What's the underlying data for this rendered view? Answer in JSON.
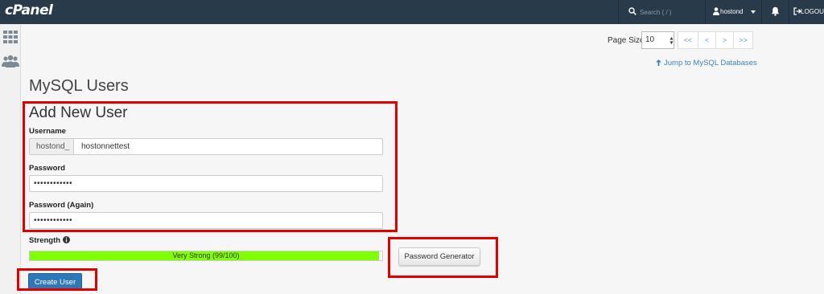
{
  "topbar": {
    "logo": "cPanel",
    "search_placeholder": "Search ( / )",
    "username": "hostond",
    "logout_label": "LOGOUT",
    "icons": [
      "search-icon",
      "user-icon",
      "chevron-down-icon",
      "bell-icon",
      "logout-icon"
    ]
  },
  "sidebar": {
    "icons": [
      "grid-icon",
      "users-icon"
    ]
  },
  "pagination": {
    "page_size_label": "Page Size",
    "page_size_value": "10",
    "first": "<<",
    "prev": "<",
    "next": ">",
    "last": ">>"
  },
  "jump_link": "Jump to MySQL Databases",
  "page_title": "MySQL Users",
  "form": {
    "title": "Add New User",
    "username_label": "Username",
    "username_prefix": "hostond_",
    "username_value": "hostonnettest",
    "password_label": "Password",
    "password_value": "••••••••••••",
    "password_again_label": "Password (Again)",
    "password_again_value": "••••••••••••",
    "strength_label": "Strength",
    "strength_text": "Very Strong (99/100)",
    "strength_score": 99,
    "strength_color": "#80ff00",
    "password_generator_label": "Password Generator",
    "create_user_label": "Create User"
  },
  "colors": {
    "topbar": "#293a4a",
    "primary_button": "#2f78b8",
    "link": "#3a84c4",
    "highlight": "#e00000"
  }
}
